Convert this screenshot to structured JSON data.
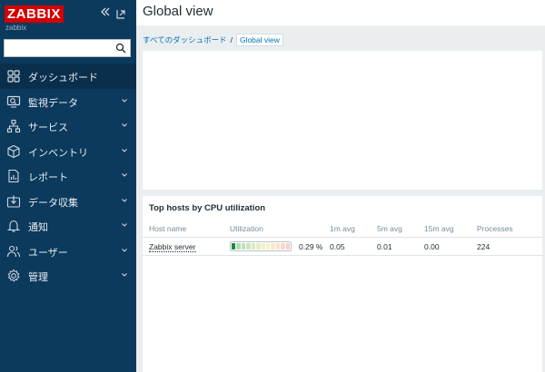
{
  "sidebar": {
    "logo": "ZABBIX",
    "server_name": "zabbix",
    "search_placeholder": "",
    "items": [
      {
        "label": "ダッシュボード",
        "icon": "dashboard-icon",
        "active": true,
        "chevron": false
      },
      {
        "label": "監視データ",
        "icon": "monitoring-icon",
        "active": false,
        "chevron": true
      },
      {
        "label": "サービス",
        "icon": "services-icon",
        "active": false,
        "chevron": true
      },
      {
        "label": "インベントリ",
        "icon": "inventory-icon",
        "active": false,
        "chevron": true
      },
      {
        "label": "レポート",
        "icon": "reports-icon",
        "active": false,
        "chevron": true
      },
      {
        "label": "データ収集",
        "icon": "data-collection-icon",
        "active": false,
        "chevron": true
      },
      {
        "label": "通知",
        "icon": "bell-icon",
        "active": false,
        "chevron": true
      },
      {
        "label": "ユーザー",
        "icon": "users-icon",
        "active": false,
        "chevron": true
      },
      {
        "label": "管理",
        "icon": "gear-icon",
        "active": false,
        "chevron": true
      }
    ]
  },
  "header": {
    "title": "Global view"
  },
  "breadcrumb": {
    "parent": "すべてのダッシュボード",
    "separator": "/",
    "current": "Global view"
  },
  "widget_hosts": {
    "title": "Top hosts by CPU utilization",
    "columns": [
      "Host name",
      "Utilization",
      "1m avg",
      "5m avg",
      "15m avg",
      "Processes"
    ],
    "rows": [
      {
        "host": "Zabbix server",
        "utilization": "0.29 %",
        "utilization_fraction": 0.0029,
        "avg1": "0.05",
        "avg5": "0.01",
        "avg15": "0.00",
        "processes": "224"
      }
    ]
  },
  "colors": {
    "sidebar_bg": "#0b3a5d",
    "logo_red": "#d40000",
    "link_blue": "#0275b8"
  }
}
